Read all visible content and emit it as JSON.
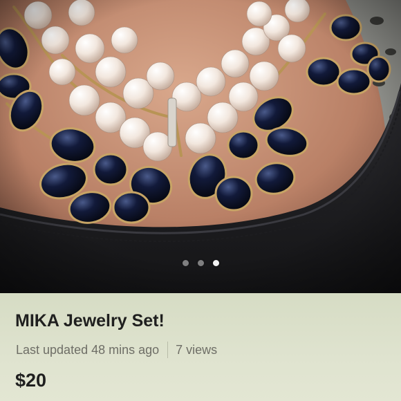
{
  "listing": {
    "title": "MIKA Jewelry Set!",
    "last_updated": "Last updated 48 mins ago",
    "views": "7 views",
    "price": "$20"
  },
  "carousel": {
    "total_images": 3,
    "active_index": 2
  },
  "colors": {
    "info_panel_bg": "#dfe3cf",
    "text_primary": "#1f1f1f",
    "text_secondary": "#6e6e66"
  }
}
